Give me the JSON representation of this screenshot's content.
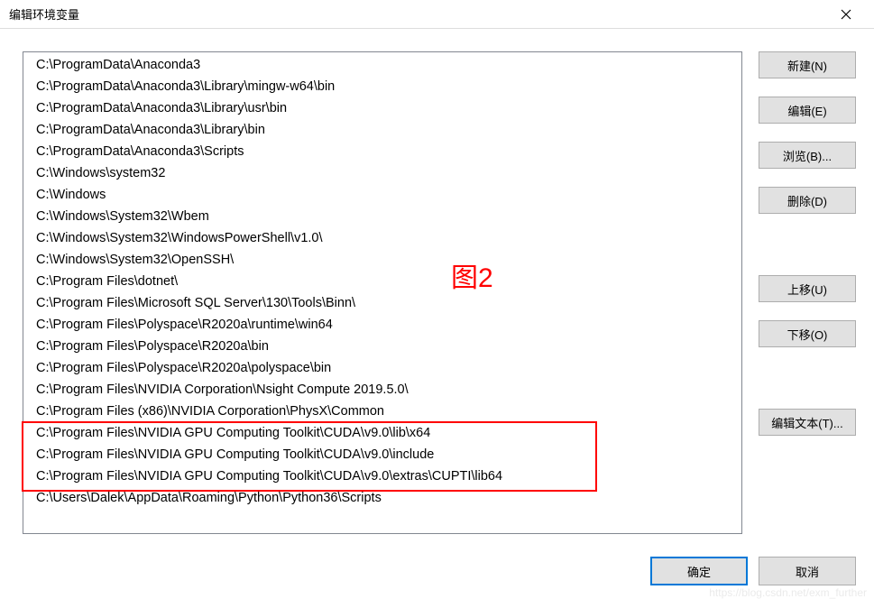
{
  "window": {
    "title": "编辑环境变量"
  },
  "paths": [
    "C:\\ProgramData\\Anaconda3",
    "C:\\ProgramData\\Anaconda3\\Library\\mingw-w64\\bin",
    "C:\\ProgramData\\Anaconda3\\Library\\usr\\bin",
    "C:\\ProgramData\\Anaconda3\\Library\\bin",
    "C:\\ProgramData\\Anaconda3\\Scripts",
    "C:\\Windows\\system32",
    "C:\\Windows",
    "C:\\Windows\\System32\\Wbem",
    "C:\\Windows\\System32\\WindowsPowerShell\\v1.0\\",
    "C:\\Windows\\System32\\OpenSSH\\",
    "C:\\Program Files\\dotnet\\",
    "C:\\Program Files\\Microsoft SQL Server\\130\\Tools\\Binn\\",
    "C:\\Program Files\\Polyspace\\R2020a\\runtime\\win64",
    "C:\\Program Files\\Polyspace\\R2020a\\bin",
    "C:\\Program Files\\Polyspace\\R2020a\\polyspace\\bin",
    "C:\\Program Files\\NVIDIA Corporation\\Nsight Compute 2019.5.0\\",
    "C:\\Program Files (x86)\\NVIDIA Corporation\\PhysX\\Common",
    "C:\\Program Files\\NVIDIA GPU Computing Toolkit\\CUDA\\v9.0\\lib\\x64",
    "C:\\Program Files\\NVIDIA GPU Computing Toolkit\\CUDA\\v9.0\\include",
    "C:\\Program Files\\NVIDIA GPU Computing Toolkit\\CUDA\\v9.0\\extras\\CUPTI\\lib64",
    "C:\\Users\\Dalek\\AppData\\Roaming\\Python\\Python36\\Scripts"
  ],
  "buttons": {
    "new": "新建(N)",
    "edit": "编辑(E)",
    "browse": "浏览(B)...",
    "delete": "删除(D)",
    "move_up": "上移(U)",
    "move_down": "下移(O)",
    "edit_text": "编辑文本(T)...",
    "ok": "确定",
    "cancel": "取消"
  },
  "annotation": {
    "label": "图2"
  },
  "watermark": "https://blog.csdn.net/exm_further"
}
